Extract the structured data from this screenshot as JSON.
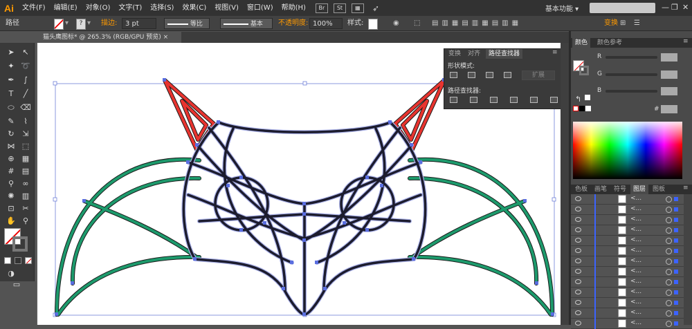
{
  "app": {
    "logo": "Ai"
  },
  "menu": [
    "文件(F)",
    "编辑(E)",
    "对象(O)",
    "文字(T)",
    "选择(S)",
    "效果(C)",
    "视图(V)",
    "窗口(W)",
    "帮助(H)"
  ],
  "menubar_icons": {
    "br": "Br",
    "st": "St"
  },
  "workspace": {
    "label": "基本功能"
  },
  "window_controls": {
    "minimize": "—",
    "restore": "❐",
    "close": "✕"
  },
  "control_bar": {
    "selection_label": "路径",
    "stroke_label": "描边:",
    "stroke_value": "3 pt",
    "profile_label": "等比",
    "brush_label": "基本",
    "opacity_label": "不透明度:",
    "opacity_value": "100%",
    "style_label": "样式:",
    "transform_label": "变换"
  },
  "document": {
    "tab_title": "猫头鹰图标* @ 265.3% (RGB/GPU 预览)",
    "close": "×"
  },
  "pathfinder_panel": {
    "tabs": [
      "变换",
      "对齐",
      "路径查找器"
    ],
    "shape_modes_label": "形状模式:",
    "expand_label": "扩展",
    "pathfinders_label": "路径查找器:"
  },
  "color_panel": {
    "tabs": [
      "颜色",
      "颜色参考"
    ],
    "channels": [
      "R",
      "G",
      "B"
    ],
    "hex_label": "#"
  },
  "layers_panel": {
    "tabs": [
      "色板",
      "画笔",
      "符号",
      "图层",
      "图板"
    ],
    "item_names": [
      "<...",
      "<...",
      "<...",
      "<...",
      "<...",
      "<...",
      "<...",
      "<...",
      "<...",
      "<...",
      "<...",
      "<...",
      "<..."
    ]
  },
  "colors": {
    "red_stroke": "#e8342f",
    "green_stroke": "#1d9a6c",
    "dark_stroke": "#1a1a2e",
    "selection": "#5a6ee0",
    "accent": "#ff9a00"
  }
}
